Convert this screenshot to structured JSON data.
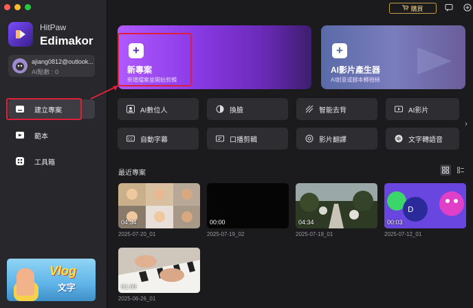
{
  "app": {
    "name_line1": "HitPaw",
    "name_line2": "Edimakor"
  },
  "account": {
    "email": "ajiang0812@outlook....",
    "credits": "AI點數 : 0"
  },
  "nav": [
    {
      "label": "建立專案",
      "icon": "new-project-icon",
      "active": true
    },
    {
      "label": "範本",
      "icon": "template-icon",
      "active": false
    },
    {
      "label": "工具箱",
      "icon": "toolbox-icon",
      "active": false
    }
  ],
  "banner": {
    "title": "Vlog",
    "subtitle": "文字"
  },
  "topbar": {
    "buy_label": "購買"
  },
  "hero": [
    {
      "title": "新專案",
      "subtitle": "新增檔案並開始剪輯"
    },
    {
      "title": "AI影片產生器",
      "subtitle": "AI創意或腳本轉視頻"
    }
  ],
  "tools_row1": [
    "AI數位人",
    "換臉",
    "智能去背",
    "AI影片"
  ],
  "tools_row2": [
    "自動字幕",
    "口播剪輯",
    "影片翻譯",
    "文字轉語音"
  ],
  "recent": {
    "title": "最近專案",
    "items": [
      {
        "duration": "04:34",
        "name": "2025-07-20_01"
      },
      {
        "duration": "00:00",
        "name": "2025-07-19_02"
      },
      {
        "duration": "04:34",
        "name": "2025-07-19_01"
      },
      {
        "duration": "00:03",
        "name": "2025-07-12_01"
      },
      {
        "duration": "01:09",
        "name": "2025-06-26_01"
      }
    ]
  },
  "colors": {
    "accent_purple": "#8a3ae6",
    "annotation_red": "#e0203a",
    "buy_gold": "#c7a04a"
  }
}
